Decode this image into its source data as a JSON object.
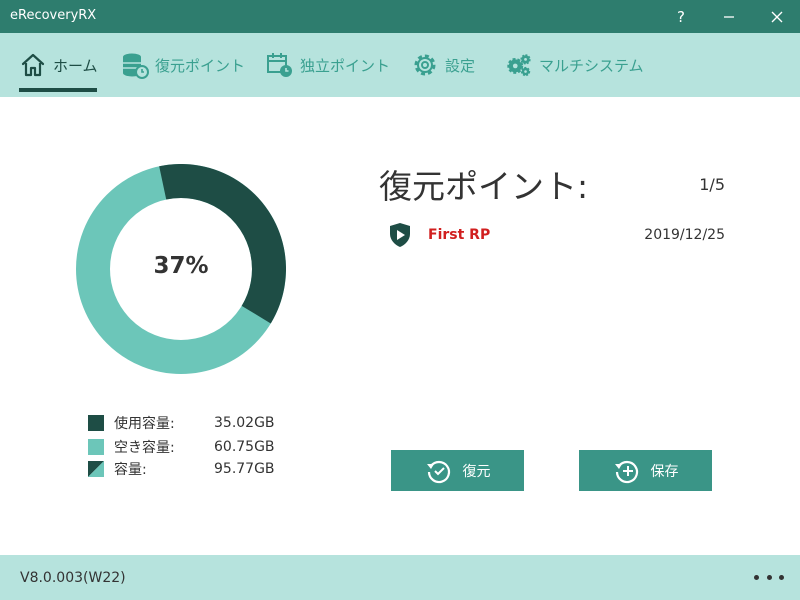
{
  "app": {
    "title": "eRecoveryRX"
  },
  "window_controls": {
    "help": "?"
  },
  "nav": {
    "items": [
      {
        "label": "ホーム",
        "icon": "home-icon",
        "active": true
      },
      {
        "label": "復元ポイント",
        "icon": "database-restore-icon",
        "active": false
      },
      {
        "label": "独立ポイント",
        "icon": "calendar-clock-icon",
        "active": false
      },
      {
        "label": "設定",
        "icon": "gear-icon",
        "active": false
      },
      {
        "label": "マルチシステム",
        "icon": "gears-icon",
        "active": false
      }
    ]
  },
  "usage": {
    "percent_label": "37%",
    "used_fraction": 0.37,
    "legend": [
      {
        "label": "使用容量:",
        "value": "35.02GB",
        "color": "#1e4d45"
      },
      {
        "label": "空き容量:",
        "value": "60.75GB",
        "color": "#6cc6b9"
      },
      {
        "label": "容量:",
        "value": "95.77GB",
        "color": "split"
      }
    ]
  },
  "restore_points": {
    "title": "復元ポイント:",
    "count": "1/5",
    "items": [
      {
        "name": "First RP",
        "date": "2019/12/25"
      }
    ]
  },
  "actions": {
    "restore_label": "復元",
    "save_label": "保存"
  },
  "footer": {
    "version": "V8.0.003(W22)"
  },
  "colors": {
    "titlebar": "#2e7d6e",
    "nav_bg": "#b6e3dd",
    "accent": "#3aa090",
    "dark": "#1e4d45",
    "light": "#6cc6b9",
    "button": "#3a9587",
    "rp_name": "#d11f1f"
  }
}
